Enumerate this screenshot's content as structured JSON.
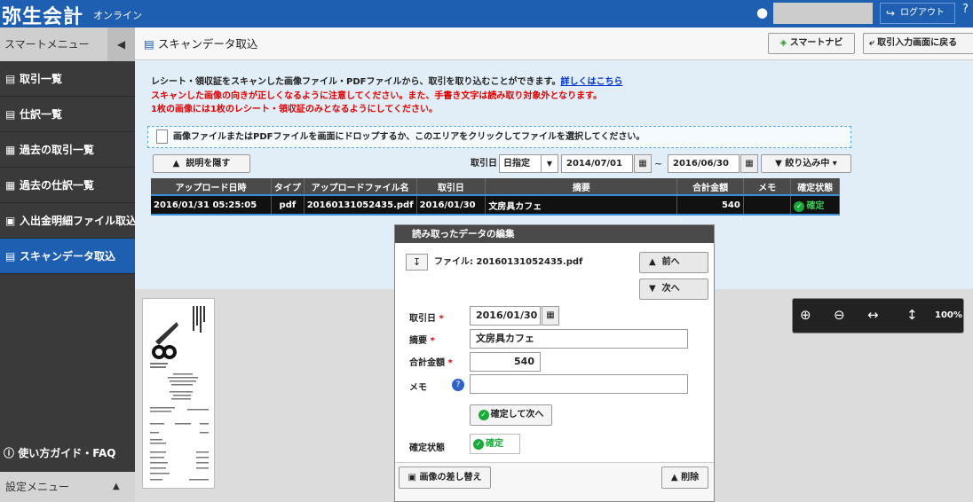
{
  "header": {
    "logo": "弥生会計",
    "logo_sub": "オンライン",
    "user_icon": "person-icon",
    "logout": "ログアウト"
  },
  "sidebar": {
    "head": "スマートメニュー",
    "items": [
      {
        "icon": "book-icon",
        "label": "取引一覧",
        "active": false
      },
      {
        "icon": "book-icon",
        "label": "仕訳一覧",
        "active": false
      },
      {
        "icon": "document-icon",
        "label": "過去の取引一覧",
        "active": false
      },
      {
        "icon": "document-icon",
        "label": "過去の仕訳一覧",
        "active": false
      },
      {
        "icon": "import-icon",
        "label": "入出金明細ファイル取込",
        "active": false
      },
      {
        "icon": "scanner-icon",
        "label": "スキャンデータ取込",
        "active": true
      }
    ],
    "guide": "使い方ガイド・FAQ",
    "settings": "設定メニュー"
  },
  "title": {
    "text": "スキャンデータ取込",
    "smart_navi": "スマートナビ",
    "back": "取引入力画面に戻る"
  },
  "description": {
    "line1": "レシート・領収証をスキャンした画像ファイル・PDFファイルから、取引を取り込むことができます。",
    "link": "詳しくはこちら",
    "line2": "スキャンした画像の向きが正しくなるように注意してください。また、手書き文字は読み取り対象外となります。",
    "line3": "1枚の画像には1枚のレシート・領収証のみとなるようにしてください。"
  },
  "dropzone": "画像ファイルまたはPDFファイルを画面にドロップするか、このエリアをクリックしてファイルを選択してください。",
  "toolbar": {
    "hide_desc": "説明を隠す",
    "date_label": "取引日",
    "date_mode": "日指定",
    "date_from": "2014/07/01",
    "tilde": "~",
    "date_to": "2016/06/30",
    "filter": "絞り込み中"
  },
  "table": {
    "headers": [
      "アップロード日時",
      "タイプ",
      "アップロードファイル名",
      "取引日",
      "摘要",
      "合計金額",
      "メモ",
      "確定状態"
    ],
    "row": {
      "uploaded": "2016/01/31 05:25:05",
      "type": "pdf",
      "filename": "20160131052435.pdf",
      "date": "2016/01/30",
      "summary": "文房具カフェ",
      "amount": "540",
      "memo": "",
      "status": "確定"
    }
  },
  "viewer": {
    "zoom": "100%"
  },
  "editor": {
    "title": "読み取ったデータの編集",
    "file_label": "ファイル: 20160131052435.pdf",
    "prev": "前へ",
    "next": "次へ",
    "date_label": "取引日",
    "date_value": "2016/01/30",
    "summary_label": "摘要",
    "summary_value": "文房具カフェ",
    "amount_label": "合計金額",
    "amount_value": "540",
    "memo_label": "メモ",
    "memo_value": "",
    "confirm_next": "確定して次へ",
    "status_label": "確定状態",
    "status_value": "確定",
    "required_mark": "*",
    "replace_image": "画像の差し替え",
    "delete": "削除"
  }
}
